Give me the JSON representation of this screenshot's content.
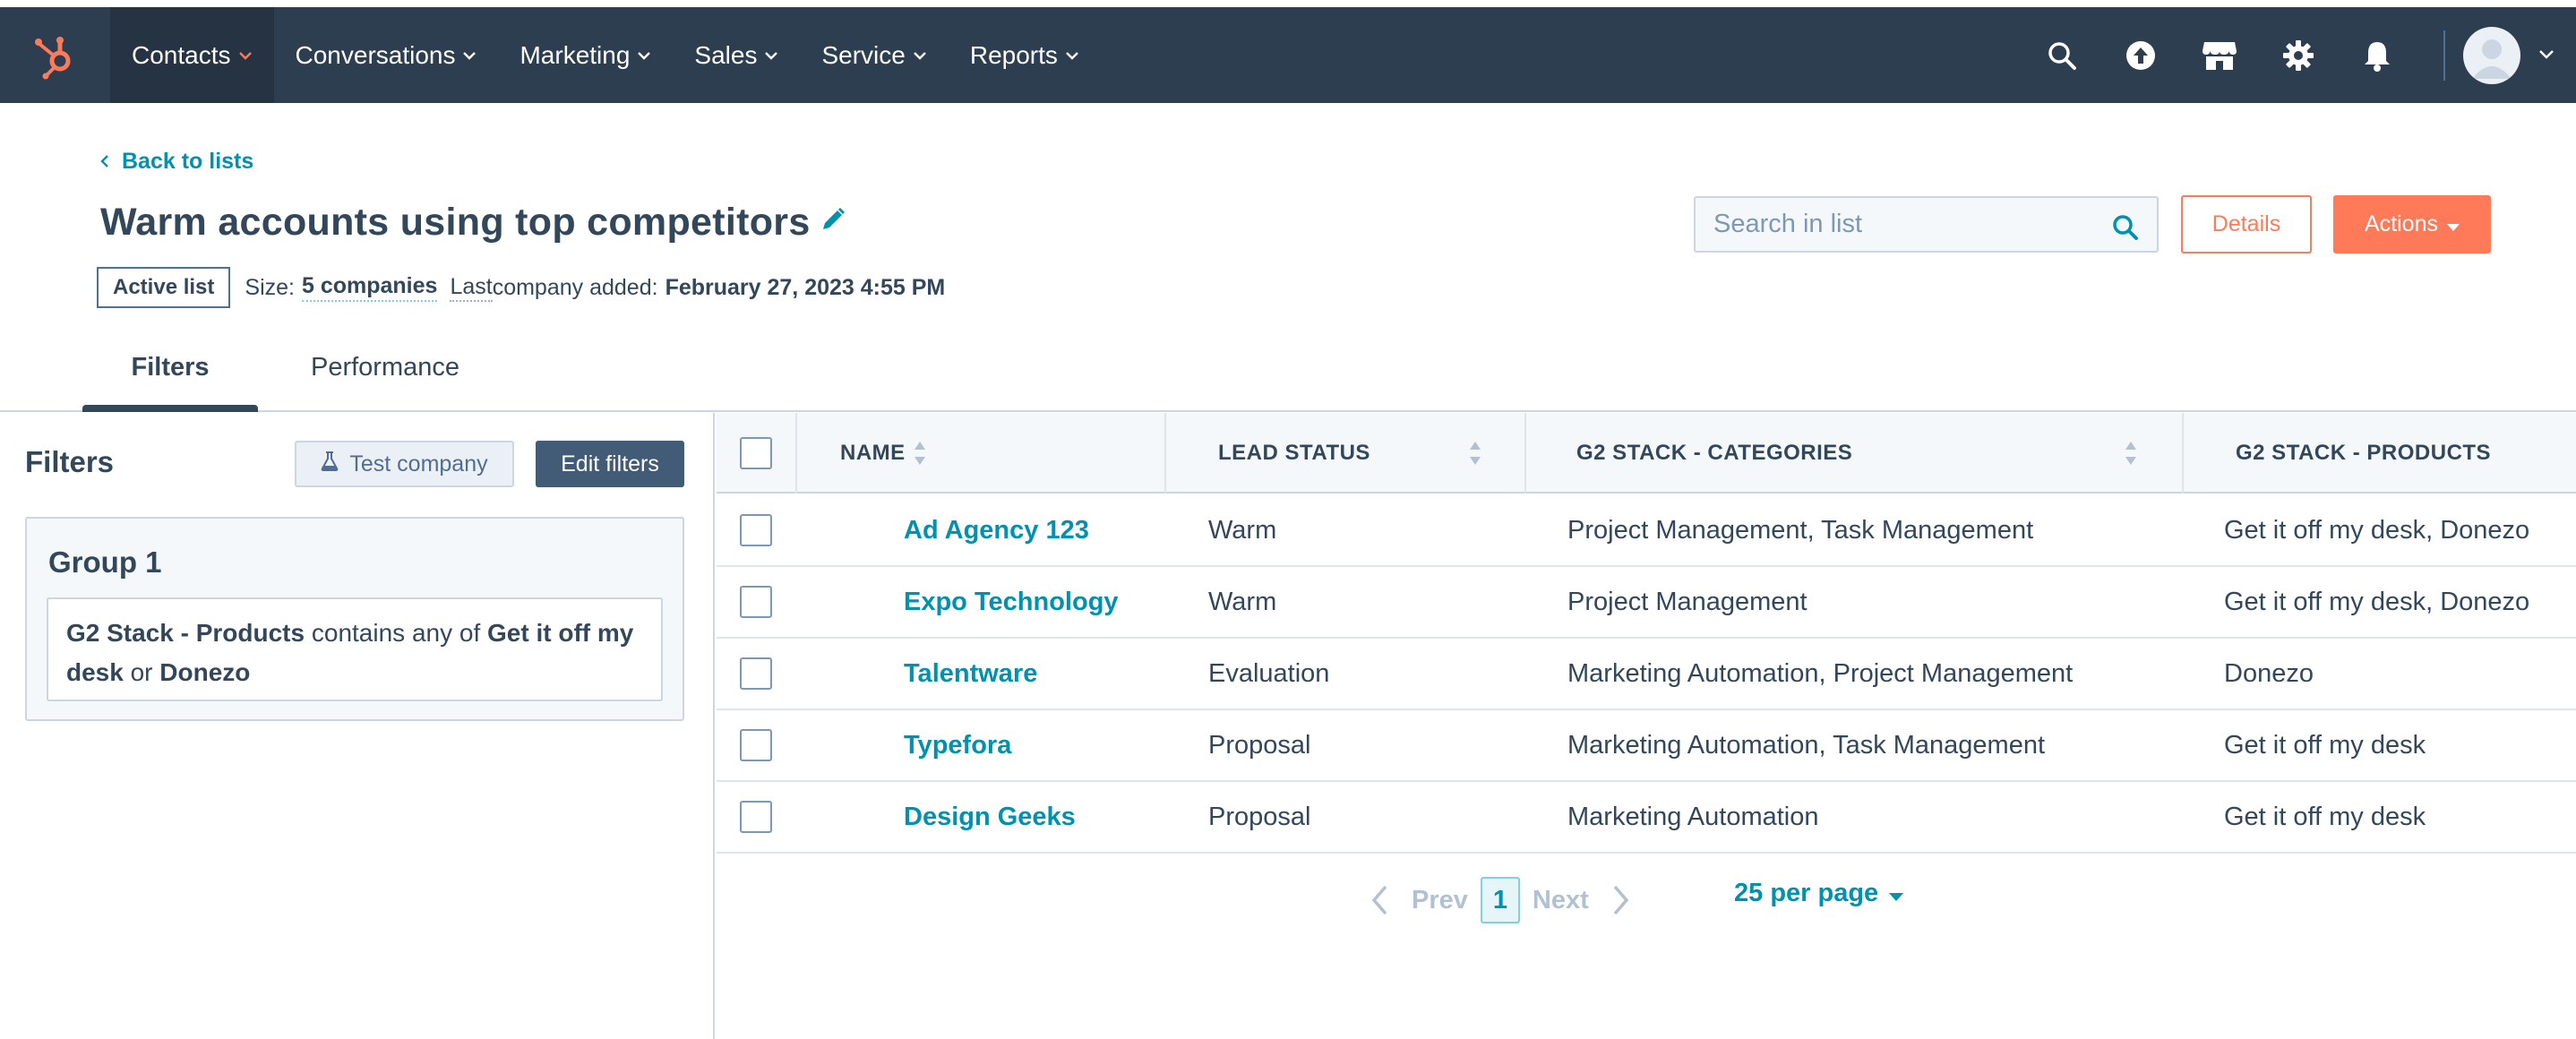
{
  "nav": {
    "items": [
      {
        "label": "Contacts",
        "active": true
      },
      {
        "label": "Conversations"
      },
      {
        "label": "Marketing"
      },
      {
        "label": "Sales"
      },
      {
        "label": "Service"
      },
      {
        "label": "Reports"
      }
    ],
    "right_icons": [
      "search-icon",
      "upgrade-icon",
      "marketplace-icon",
      "settings-icon",
      "notifications-icon"
    ],
    "brand_color": "#2d3e50",
    "accent_color": "#ff7a59"
  },
  "header": {
    "back_label": "Back to lists",
    "title": "Warm accounts using top competitors",
    "list_type": "Active list",
    "size_prefix": "Size:",
    "size_value": "5 companies",
    "last_prefix_a": "Last",
    "last_prefix_b": " company added:",
    "last_added": "February 27, 2023 4:55 PM",
    "search_placeholder": "Search in list",
    "details_label": "Details",
    "actions_label": "Actions"
  },
  "tabs": [
    {
      "label": "Filters",
      "active": true
    },
    {
      "label": "Performance"
    }
  ],
  "filters": {
    "title": "Filters",
    "test_label": "Test company",
    "edit_label": "Edit filters",
    "group_title": "Group 1",
    "rule": {
      "property": "G2 Stack - Products",
      "operator": "contains any of",
      "value1": "Get it off my desk",
      "joiner": "or",
      "value2": "Donezo"
    }
  },
  "table": {
    "columns": [
      "NAME",
      "LEAD STATUS",
      "G2 STACK - CATEGORIES",
      "G2 STACK - PRODUCTS"
    ],
    "rows": [
      {
        "name": "Ad Agency 123",
        "lead_status": "Warm",
        "categories": "Project Management, Task Management",
        "products": "Get it off my desk, Donezo"
      },
      {
        "name": "Expo Technology",
        "lead_status": "Warm",
        "categories": "Project Management",
        "products": "Get it off my desk, Donezo"
      },
      {
        "name": "Talentware",
        "lead_status": "Evaluation",
        "categories": "Marketing Automation, Project Management",
        "products": "Donezo"
      },
      {
        "name": "Typefora",
        "lead_status": "Proposal",
        "categories": "Marketing Automation, Task Management",
        "products": "Get it off my desk"
      },
      {
        "name": "Design Geeks",
        "lead_status": "Proposal",
        "categories": "Marketing Automation",
        "products": "Get it off my desk"
      }
    ]
  },
  "pagination": {
    "prev_label": "Prev",
    "current_page": "1",
    "next_label": "Next",
    "per_page_label": "25 per page"
  }
}
